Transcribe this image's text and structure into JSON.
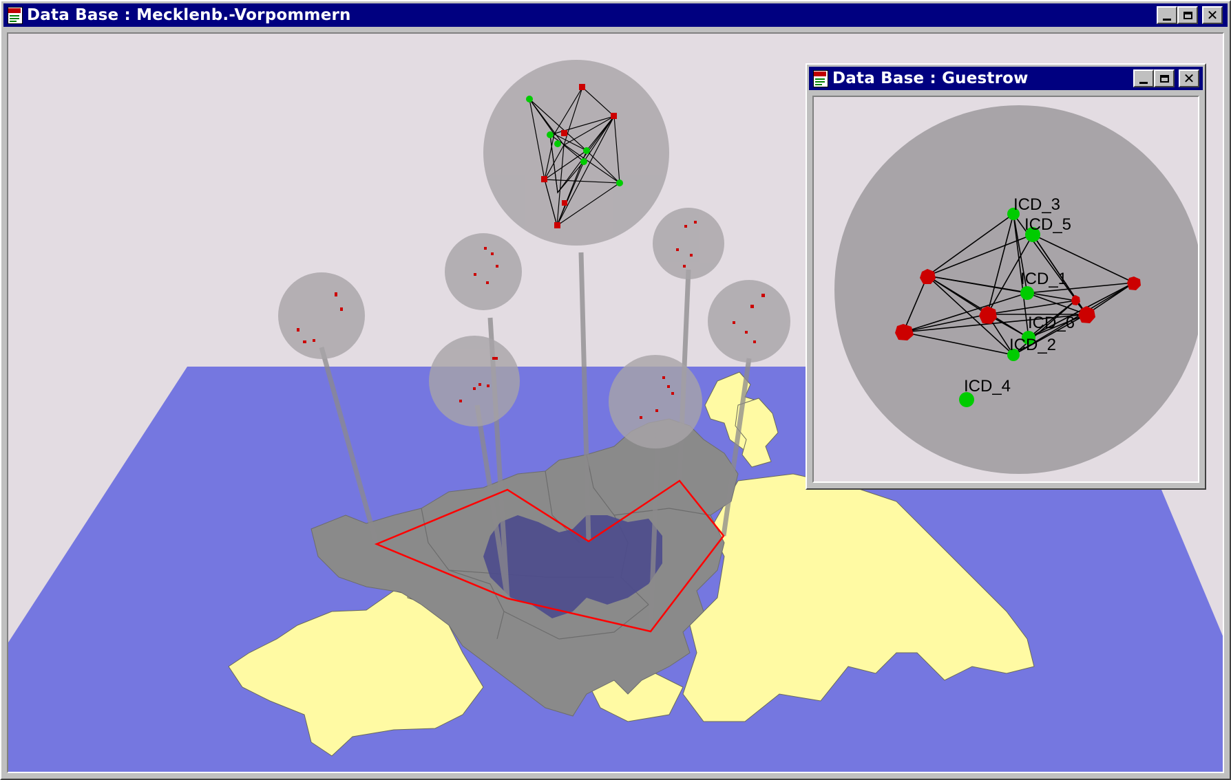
{
  "main_window": {
    "title": "Data Base : Mecklenb.-Vorpommern",
    "app_icon": "dok-document-icon",
    "app_icon_text": "DOK",
    "controls": [
      "minimize-icon",
      "maximize-icon",
      "close-icon"
    ]
  },
  "sub_window": {
    "title": "Data Base : Guestrow",
    "app_icon": "dok-document-icon",
    "app_icon_text": "DOK",
    "controls": [
      "minimize-icon",
      "maximize-icon",
      "close-icon"
    ],
    "node_labels": {
      "icd_1": "ICD_1",
      "icd_2": "ICD_2",
      "icd_3": "ICD_3",
      "icd_4": "ICD_4",
      "icd_5": "ICD_5",
      "icd_6": "ICD_6"
    }
  },
  "colors": {
    "window_title_bar": "#000080",
    "scene_background": "#e3dce2",
    "sea": "#7577e0",
    "land": "#fffaa3",
    "region": "#8a8a8a",
    "selected_region": "#4d4c8c",
    "selection_outline": "#ff0000",
    "bubble": "#a8a4a8",
    "node_red": "#cc0000",
    "node_green": "#00cc00"
  }
}
